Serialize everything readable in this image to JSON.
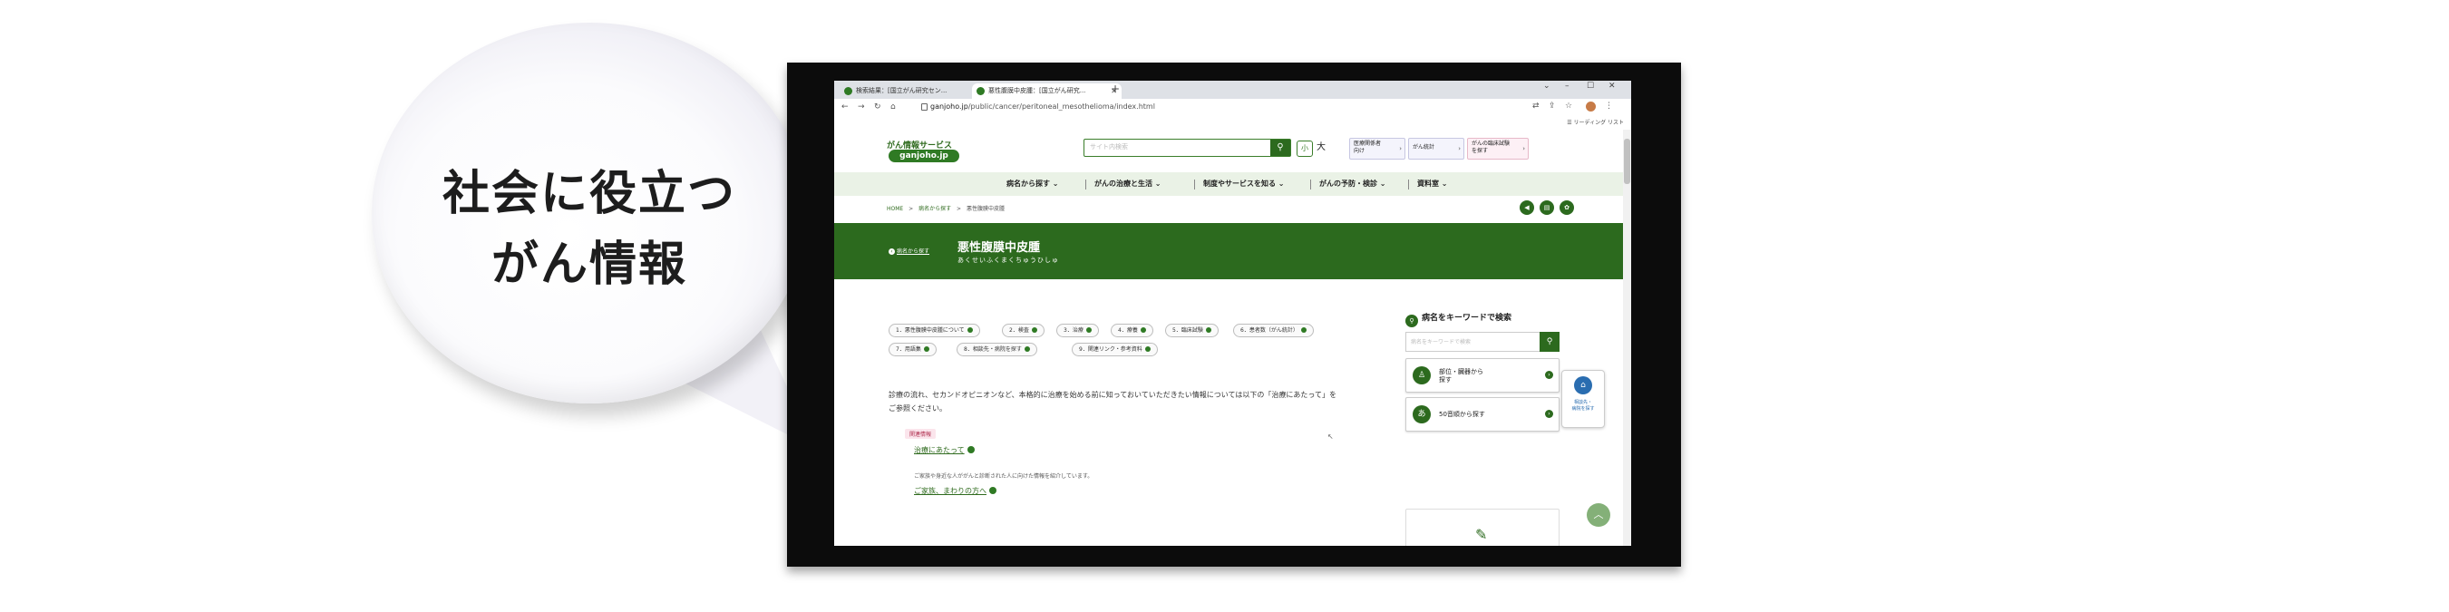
{
  "bubble": {
    "line1": "社会に役立つ",
    "line2": "がん情報"
  },
  "browser": {
    "tabs": [
      {
        "label": "検索結果：[国立がん研究セン..."
      },
      {
        "label": "悪性腹膜中皮腫：[国立がん研究..."
      }
    ],
    "url_host": "ganjoho.jp",
    "url_path": "/public/cancer/peritoneal_mesothelioma/index.html",
    "reading_list": "リーディング リスト"
  },
  "site": {
    "logo_top": "がん情報サービス",
    "logo_badge": "ganjoho.jp",
    "search_placeholder": "サイト内検索",
    "font_small": "小",
    "font_large": "大",
    "header_links": [
      {
        "label1": "医療関係者",
        "label2": "向け"
      },
      {
        "label1": "がん統計",
        "label2": ""
      },
      {
        "label1": "がんの臨床試験",
        "label2": "を探す"
      }
    ],
    "gnav": [
      "病名から探す ⌄",
      "がんの治療と生活 ⌄",
      "制度やサービスを知る ⌄",
      "がんの予防・検診 ⌄",
      "資料室 ⌄"
    ],
    "breadcrumb": [
      "HOME",
      ">",
      "病名から探す",
      ">",
      "悪性腹膜中皮腫"
    ],
    "back_link": "病名から探す",
    "page_title": "悪性腹膜中皮腫",
    "page_reading": "あくせいふくまくちゅうひしゅ",
    "chips": [
      "1．悪性腹膜中皮腫について",
      "2．検査",
      "3．治療",
      "4．療養",
      "5．臨床試験",
      "6．患者数（がん統計）",
      "7．用語集",
      "8．相談先・病院を探す",
      "9．関連リンク・参考資料"
    ],
    "body_line1": "診療の流れ、セカンドオピニオンなど、本格的に治療を始める前に知っておいていただきたい情報については以下の「治療にあたって」を",
    "body_line2": "ご参照ください。",
    "related_tag": "関連情報",
    "related_link1": "治療にあたって",
    "related_note": "ご家族や身近な人ががんと診断された人に向けた情報を紹介しています。",
    "related_link2": "ご家族、まわりの方へ",
    "side_title": "病名をキーワードで検索",
    "side_search_placeholder": "病名をキーワードで検索",
    "side_card1_l1": "部位・臓器から",
    "side_card1_l2": "探す",
    "side_card2": "50音順から探す",
    "float_l1": "相談先・",
    "float_l2": "病院を探す"
  }
}
